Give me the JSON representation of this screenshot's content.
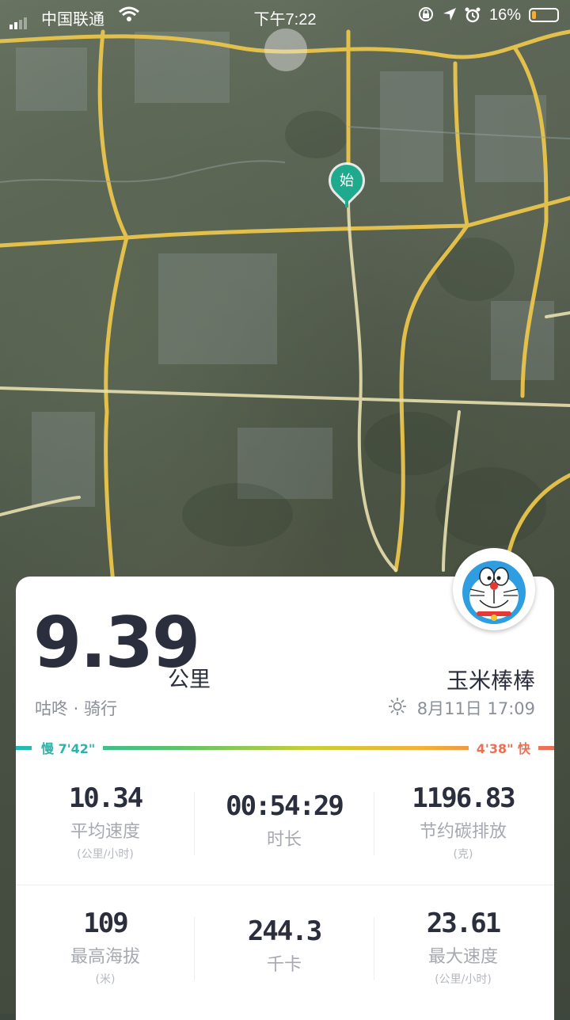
{
  "status_bar": {
    "carrier": "中国联通",
    "time": "下午7:22",
    "battery": "16%"
  },
  "map": {
    "start_marker_label": "始"
  },
  "activity": {
    "distance": "9.39",
    "distance_unit": "公里",
    "subtitle": "咕咚 · 骑行",
    "username": "玉米棒棒",
    "datetime": "8月11日 17:09"
  },
  "pace": {
    "slow_label": "慢 7'42\"",
    "fast_label": "4'38\" 快"
  },
  "stats": [
    {
      "value": "10.34",
      "label": "平均速度",
      "unit": "(公里/小时)"
    },
    {
      "value": "00:54:29",
      "label": "时长",
      "unit": ""
    },
    {
      "value": "1196.83",
      "label": "节约碳排放",
      "unit": "(克)"
    },
    {
      "value": "109",
      "label": "最高海拔",
      "unit": "(米)"
    },
    {
      "value": "244.3",
      "label": "千卡",
      "unit": ""
    },
    {
      "value": "23.61",
      "label": "最大速度",
      "unit": "(公里/小时)"
    }
  ]
}
